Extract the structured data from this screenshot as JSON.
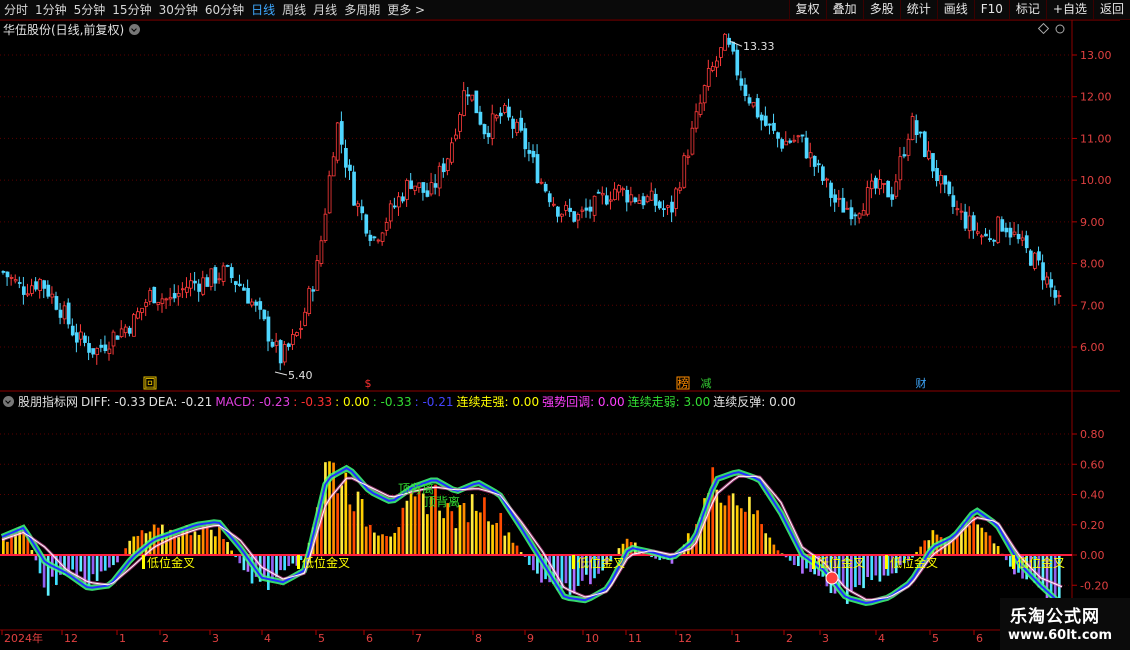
{
  "toolbar": {
    "periods": [
      "分时",
      "1分钟",
      "5分钟",
      "15分钟",
      "30分钟",
      "60分钟",
      "日线",
      "周线",
      "月线",
      "多周期",
      "更多 >"
    ],
    "active_index": 6,
    "buttons": [
      "复权",
      "叠加",
      "多股",
      "统计",
      "画线",
      "F10",
      "标记",
      "+自选",
      "返回"
    ]
  },
  "stock": {
    "title": "华伍股份(日线,前复权)",
    "high_label": "13.33",
    "low_label": "5.40",
    "price_axis": [
      "13.00",
      "12.00",
      "11.00",
      "10.00",
      "9.00",
      "8.00",
      "7.00",
      "6.00"
    ],
    "event_marks": [
      {
        "text": "回",
        "color": "#e8c000"
      },
      {
        "text": "$",
        "color": "#ff3030"
      },
      {
        "text": "榜",
        "color": "#ff8c00"
      },
      {
        "text": "减",
        "color": "#33cc33"
      },
      {
        "text": "财",
        "color": "#3fa9ff"
      }
    ]
  },
  "indicator": {
    "name": "股朋指标网",
    "values": [
      {
        "text": "DIFF: -0.33",
        "color": "#e0e0e0"
      },
      {
        "text": "DEA: -0.21",
        "color": "#e0e0e0"
      },
      {
        "text": "MACD: -0.23",
        "color": "#e040e0"
      },
      {
        "text": ": -0.33",
        "color": "#ff3030"
      },
      {
        "text": ": 0.00",
        "color": "#ffff00"
      },
      {
        "text": ": -0.33",
        "color": "#33dd33"
      },
      {
        "text": ": -0.21",
        "color": "#4444ff"
      },
      {
        "text": "连续走强: 0.00",
        "color": "#ffff00"
      },
      {
        "text": "强势回调: 0.00",
        "color": "#ff40ff"
      },
      {
        "text": "连续走弱: 3.00",
        "color": "#33dd33"
      },
      {
        "text": "连续反弹: 0.00",
        "color": "#e0e0e0"
      }
    ],
    "axis": [
      "0.80",
      "0.60",
      "0.40",
      "0.20",
      "0.00",
      "-0.20"
    ],
    "annotations": [
      {
        "text": "顶背离",
        "color": "#33dd33"
      },
      {
        "text": "顶背离",
        "color": "#33dd33"
      },
      {
        "text": "低位金叉",
        "color": "#ffff00"
      },
      {
        "text": "低位金叉",
        "color": "#ffff00"
      },
      {
        "text": "低位金叉",
        "color": "#ffff00"
      },
      {
        "text": "低位金叉",
        "color": "#ffff00"
      },
      {
        "text": "低位金叉",
        "color": "#ffff00"
      },
      {
        "text": "低位金叉",
        "color": "#ffff00"
      }
    ]
  },
  "date_axis": [
    "2024年",
    "12",
    "1",
    "2",
    "3",
    "4",
    "5",
    "6",
    "7",
    "8",
    "9",
    "10",
    "11",
    "12",
    "1",
    "2",
    "3",
    "4",
    "5",
    "6"
  ],
  "watermark": {
    "main": "乐淘公式网",
    "sub": "www.60lt.com"
  },
  "chart_data": {
    "type": "candlestick",
    "title": "华伍股份(日线,前复权)",
    "price_range": [
      5.0,
      14.0
    ],
    "max_price": 13.33,
    "min_price": 5.4,
    "last_close": 6.95,
    "close_path": [
      7.8,
      7.4,
      7.6,
      7.0,
      6.2,
      5.9,
      6.3,
      6.6,
      7.3,
      7.1,
      7.5,
      7.6,
      7.8,
      7.4,
      6.6,
      5.7,
      6.4,
      8.0,
      11.4,
      9.5,
      8.6,
      9.3,
      10.0,
      9.6,
      10.6,
      12.3,
      11.2,
      11.6,
      11.0,
      10.0,
      9.3,
      9.1,
      9.4,
      9.8,
      9.6,
      9.5,
      9.2,
      10.8,
      12.4,
      13.3,
      12.2,
      11.4,
      10.9,
      11.0,
      10.2,
      9.4,
      9.3,
      9.8,
      9.7,
      11.4,
      10.5,
      9.5,
      9.0,
      8.6,
      9.0,
      8.4,
      7.9,
      7.0
    ],
    "macd_range": [
      -0.35,
      0.95
    ],
    "diff_path": [
      0.12,
      0.18,
      -0.05,
      -0.12,
      -0.22,
      -0.2,
      -0.02,
      0.1,
      0.15,
      0.2,
      0.22,
      0.05,
      -0.15,
      -0.18,
      -0.1,
      0.5,
      0.58,
      0.42,
      0.35,
      0.45,
      0.5,
      0.42,
      0.48,
      0.4,
      0.18,
      -0.05,
      -0.28,
      -0.3,
      -0.22,
      0.05,
      0.02,
      -0.02,
      0.1,
      0.5,
      0.55,
      0.5,
      0.28,
      0.0,
      -0.1,
      -0.28,
      -0.32,
      -0.28,
      -0.18,
      0.05,
      0.12,
      0.3,
      0.2,
      -0.05,
      -0.2,
      -0.33
    ],
    "dea_path": [
      0.1,
      0.15,
      0.05,
      -0.1,
      -0.18,
      -0.2,
      -0.08,
      0.05,
      0.12,
      0.17,
      0.2,
      0.1,
      -0.08,
      -0.16,
      -0.12,
      0.35,
      0.52,
      0.45,
      0.38,
      0.42,
      0.45,
      0.43,
      0.44,
      0.4,
      0.22,
      0.02,
      -0.22,
      -0.28,
      -0.24,
      0.0,
      0.03,
      0.0,
      0.05,
      0.4,
      0.52,
      0.52,
      0.35,
      0.05,
      -0.05,
      -0.22,
      -0.3,
      -0.28,
      -0.2,
      0.0,
      0.1,
      0.25,
      0.22,
      0.0,
      -0.15,
      -0.21
    ]
  }
}
